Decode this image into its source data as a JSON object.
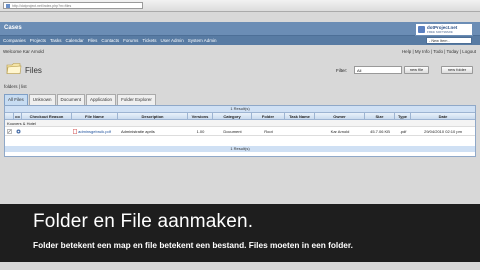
{
  "browser": {
    "url": "http://dotproject.net/index.php?m=files"
  },
  "app": {
    "title": "Cases",
    "logo_title": "dotProject.net",
    "logo_subtitle": "FREE SOFTWARE"
  },
  "menu": {
    "items": [
      "Companies",
      "Projects",
      "Tasks",
      "Calendar",
      "Files",
      "Contacts",
      "Forums",
      "Tickets",
      "User Admin",
      "System Admin"
    ],
    "new_item_select": "- New Item -"
  },
  "welcome": "Welcome Kar Arnold",
  "top_links": "Help | My Info | Todo | Today | Logout",
  "page": {
    "title": "Files",
    "filter_label": "Filter:",
    "filter_value": "All",
    "new_file_button": "new file",
    "new_folder_button": "new folder",
    "breadcrumb": "folders | list"
  },
  "tabs": [
    "All Files",
    "Unknown",
    "Document",
    "Application",
    "Folder Explorer"
  ],
  "table": {
    "results_text": "1 Result(s)",
    "columns": [
      "co",
      "Checkout Reason",
      "File Name",
      "Description",
      "Versions",
      "Category",
      "Folder",
      "Task Name",
      "Owner",
      "Size",
      "Type",
      "Date"
    ],
    "group_label": "Kouvers & Hotel",
    "rows": [
      {
        "file_name": "adminsgebruik.pdf",
        "description": "Administratie aprils",
        "versions": "1.00",
        "category": "Document",
        "folder": "Root",
        "task_name": "",
        "owner": "Kar Arnold",
        "size": "45.7.06 KB",
        "type": ".pdf",
        "date": "29/04/2010 02:10 pm"
      }
    ]
  },
  "caption": {
    "title": "Folder en File aanmaken.",
    "subtitle": "Folder betekent een map en file betekent een bestand. Files moeten in een folder."
  }
}
